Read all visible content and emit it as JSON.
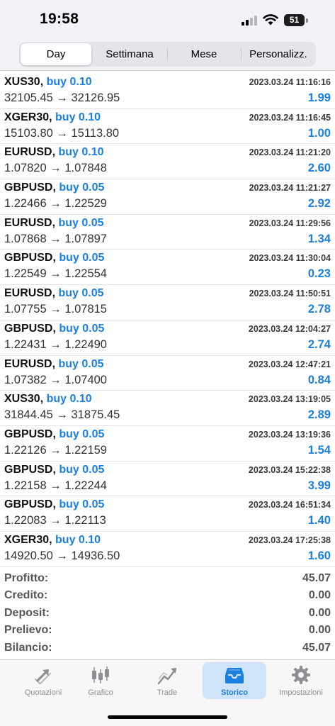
{
  "status_bar": {
    "time": "19:58",
    "battery": "51"
  },
  "period_tabs": [
    {
      "label": "Day",
      "active": true
    },
    {
      "label": "Settimana",
      "active": false
    },
    {
      "label": "Mese",
      "active": false
    },
    {
      "label": "Personalizz.",
      "active": false
    }
  ],
  "deals": [
    {
      "symbol": "XUS30",
      "side": "buy 0.10",
      "open": "32105.45",
      "close": "32126.95",
      "time": "2023.03.24 11:16:16",
      "profit": "1.99"
    },
    {
      "symbol": "XGER30",
      "side": "buy 0.10",
      "open": "15103.80",
      "close": "15113.80",
      "time": "2023.03.24 11:16:45",
      "profit": "1.00"
    },
    {
      "symbol": "EURUSD",
      "side": "buy 0.10",
      "open": "1.07820",
      "close": "1.07848",
      "time": "2023.03.24 11:21:20",
      "profit": "2.60"
    },
    {
      "symbol": "GBPUSD",
      "side": "buy 0.05",
      "open": "1.22466",
      "close": "1.22529",
      "time": "2023.03.24 11:21:27",
      "profit": "2.92"
    },
    {
      "symbol": "EURUSD",
      "side": "buy 0.05",
      "open": "1.07868",
      "close": "1.07897",
      "time": "2023.03.24 11:29:56",
      "profit": "1.34"
    },
    {
      "symbol": "GBPUSD",
      "side": "buy 0.05",
      "open": "1.22549",
      "close": "1.22554",
      "time": "2023.03.24 11:30:04",
      "profit": "0.23"
    },
    {
      "symbol": "EURUSD",
      "side": "buy 0.05",
      "open": "1.07755",
      "close": "1.07815",
      "time": "2023.03.24 11:50:51",
      "profit": "2.78"
    },
    {
      "symbol": "GBPUSD",
      "side": "buy 0.05",
      "open": "1.22431",
      "close": "1.22490",
      "time": "2023.03.24 12:04:27",
      "profit": "2.74"
    },
    {
      "symbol": "EURUSD",
      "side": "buy 0.05",
      "open": "1.07382",
      "close": "1.07400",
      "time": "2023.03.24 12:47:21",
      "profit": "0.84"
    },
    {
      "symbol": "XUS30",
      "side": "buy 0.10",
      "open": "31844.45",
      "close": "31875.45",
      "time": "2023.03.24 13:19:05",
      "profit": "2.89"
    },
    {
      "symbol": "GBPUSD",
      "side": "buy 0.05",
      "open": "1.22126",
      "close": "1.22159",
      "time": "2023.03.24 13:19:36",
      "profit": "1.54"
    },
    {
      "symbol": "GBPUSD",
      "side": "buy 0.05",
      "open": "1.22158",
      "close": "1.22244",
      "time": "2023.03.24 15:22:38",
      "profit": "3.99"
    },
    {
      "symbol": "GBPUSD",
      "side": "buy 0.05",
      "open": "1.22083",
      "close": "1.22113",
      "time": "2023.03.24 16:51:34",
      "profit": "1.40"
    },
    {
      "symbol": "XGER30",
      "side": "buy 0.10",
      "open": "14920.50",
      "close": "14936.50",
      "time": "2023.03.24 17:25:38",
      "profit": "1.60"
    }
  ],
  "summary": [
    {
      "label": "Profitto:",
      "value": "45.07"
    },
    {
      "label": "Credito:",
      "value": "0.00"
    },
    {
      "label": "Deposit:",
      "value": "0.00"
    },
    {
      "label": "Prelievo:",
      "value": "0.00"
    },
    {
      "label": "Bilancio:",
      "value": "45.07"
    }
  ],
  "tabbar": [
    {
      "label": "Quotazioni",
      "icon": "quotes-arrows-icon",
      "active": false
    },
    {
      "label": "Grafico",
      "icon": "candlestick-chart-icon",
      "active": false
    },
    {
      "label": "Trade",
      "icon": "trade-chart-icon",
      "active": false
    },
    {
      "label": "Storico",
      "icon": "history-tray-icon",
      "active": true
    },
    {
      "label": "Impostazioni",
      "icon": "gear-icon",
      "active": false
    }
  ],
  "colors": {
    "accent": "#1b7fe0",
    "tab_active_bg": "#cfe3fb",
    "inactive": "#8e8e93"
  }
}
